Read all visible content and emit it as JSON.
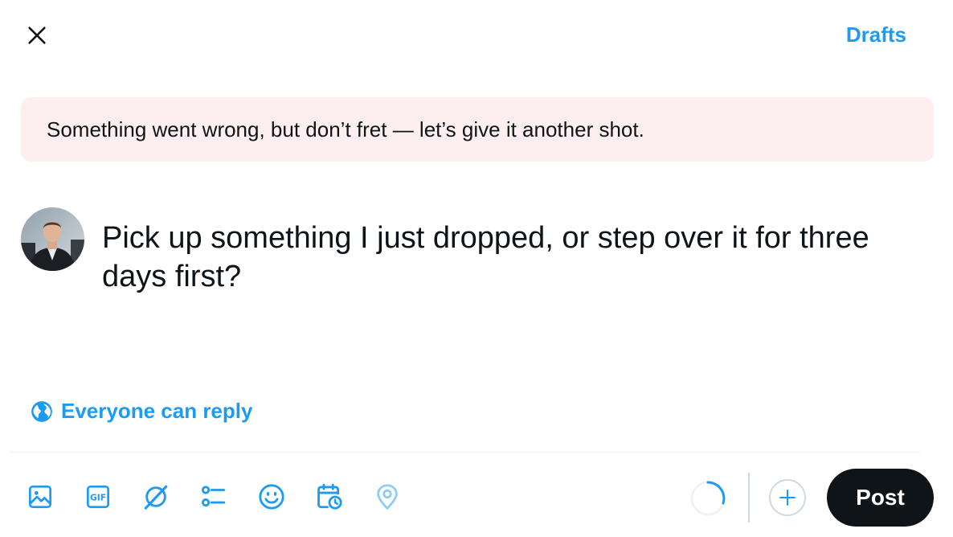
{
  "header": {
    "close_icon": "close-icon",
    "drafts_label": "Drafts"
  },
  "error_banner": {
    "message": "Something went wrong, but don’t fret — let’s give it another shot."
  },
  "composer": {
    "text": "Pick up something I just dropped, or step over it for three days first?",
    "avatar": "user-avatar"
  },
  "reply_setting": {
    "icon": "globe-icon",
    "label": "Everyone can reply"
  },
  "toolbar": {
    "tools": [
      "image-icon",
      "gif-icon",
      "grok-icon",
      "poll-icon",
      "emoji-icon",
      "schedule-icon",
      "location-icon"
    ],
    "add_icon": "plus-icon",
    "post_label": "Post"
  },
  "colors": {
    "accent": "#1d9bf0",
    "banner_bg": "#fdeff0",
    "post_bg": "#0f1419"
  }
}
